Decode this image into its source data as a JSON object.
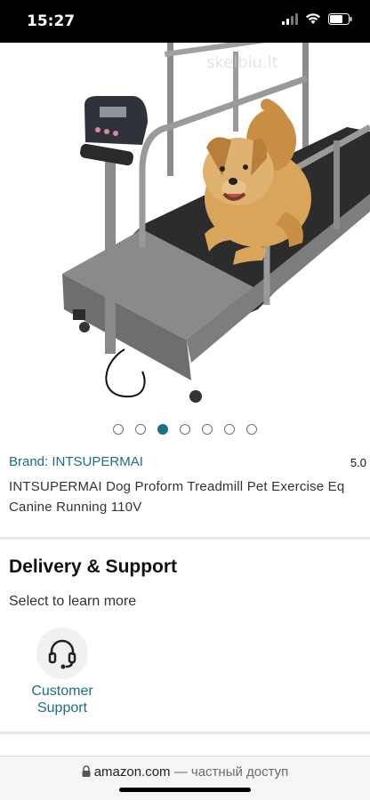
{
  "status_bar": {
    "time": "15:27"
  },
  "product_image": {
    "watermark": "skelbiu.lt"
  },
  "carousel": {
    "total": 7,
    "active_index": 2
  },
  "product": {
    "brand": "Brand: INTSUPERMAI",
    "rating": "5.0",
    "title_line1": "INTSUPERMAI Dog Proform Treadmill Pet Exercise Eq",
    "title_line2": "Canine Running 110V"
  },
  "delivery": {
    "heading": "Delivery & Support",
    "subtitle": "Select to learn more",
    "tile_label_line1": "Customer",
    "tile_label_line2": "Support",
    "tile_icon": "headset-icon"
  },
  "browser": {
    "domain": "amazon.com",
    "suffix": " — частный доступ"
  },
  "colors": {
    "link": "#1d6f82",
    "active_dot": "#1d6f82"
  }
}
